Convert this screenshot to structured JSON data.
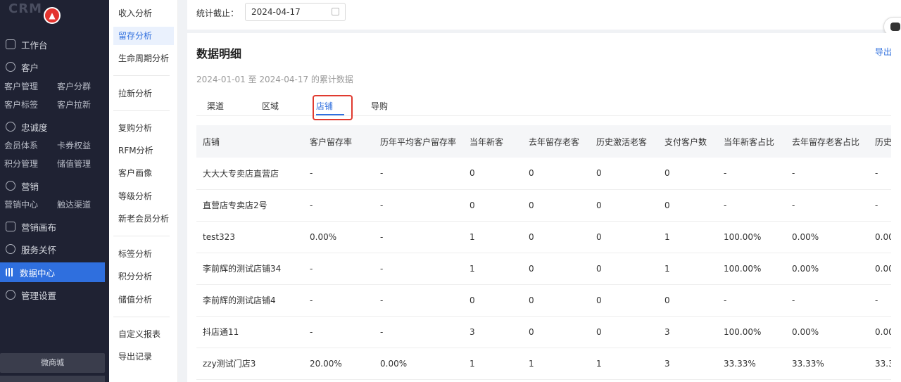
{
  "brand": {
    "text": "CRM",
    "logo_icon": "thumbs-up-icon"
  },
  "sidebar": {
    "items": [
      {
        "label": "工作台",
        "icon": "monitor-icon"
      },
      {
        "label": "客户",
        "icon": "user-icon",
        "subs": [
          [
            "客户管理",
            "客户分群"
          ],
          [
            "客户标签",
            "客户拉新"
          ]
        ]
      },
      {
        "label": "忠诚度",
        "icon": "smile-icon",
        "subs": [
          [
            "会员体系",
            "卡券权益"
          ],
          [
            "积分管理",
            "储值管理"
          ]
        ]
      },
      {
        "label": "营销",
        "icon": "target-icon",
        "subs": [
          [
            "营销中心",
            "触达渠道"
          ]
        ]
      },
      {
        "label": "营销画布",
        "icon": "clipboard-icon"
      },
      {
        "label": "服务关怀",
        "icon": "flask-icon"
      },
      {
        "label": "数据中心",
        "icon": "bar-chart-icon",
        "active": true
      },
      {
        "label": "管理设置",
        "icon": "gear-icon"
      }
    ],
    "store_button": "微商城"
  },
  "submenu": {
    "groups": [
      [
        "收入分析",
        "留存分析",
        "生命周期分析"
      ],
      [
        "拉新分析"
      ],
      [
        "复购分析",
        "RFM分析",
        "客户画像",
        "等级分析",
        "新老会员分析"
      ],
      [
        "标签分析",
        "积分分析",
        "储值分析"
      ],
      [
        "自定义报表",
        "导出记录"
      ]
    ],
    "active": "留存分析"
  },
  "filter": {
    "label": "统计截止：",
    "date": "2024-04-17"
  },
  "panel": {
    "title": "数据明细",
    "export": "导出",
    "range": "2024-01-01 至 2024-04-17 的累计数据",
    "tabs": [
      "渠道",
      "区域",
      "店铺",
      "导购"
    ],
    "active_tab": "店铺"
  },
  "table": {
    "headers": [
      "店铺",
      "客户留存率",
      "历年平均客户留存率",
      "当年新客",
      "去年留存老客",
      "历史激活老客",
      "支付客户数",
      "当年新客占比",
      "去年留存老客占比",
      "历史"
    ],
    "rows": [
      [
        "大大大专卖店直营店",
        "-",
        "-",
        "0",
        "0",
        "0",
        "0",
        "-",
        "-",
        "-"
      ],
      [
        "直营店专卖店2号",
        "-",
        "-",
        "0",
        "0",
        "0",
        "0",
        "-",
        "-",
        "-"
      ],
      [
        "test323",
        "0.00%",
        "-",
        "1",
        "0",
        "0",
        "1",
        "100.00%",
        "0.00%",
        "0.00"
      ],
      [
        "李前辉的测试店铺34",
        "-",
        "-",
        "1",
        "0",
        "0",
        "1",
        "100.00%",
        "0.00%",
        "0.00"
      ],
      [
        "李前辉的测试店铺4",
        "-",
        "-",
        "0",
        "0",
        "0",
        "0",
        "-",
        "-",
        "-"
      ],
      [
        "抖店通11",
        "-",
        "-",
        "3",
        "0",
        "0",
        "3",
        "100.00%",
        "0.00%",
        "0.00"
      ],
      [
        "zzy测试门店3",
        "20.00%",
        "0.00%",
        "1",
        "1",
        "1",
        "3",
        "33.33%",
        "33.33%",
        "33.3"
      ]
    ]
  }
}
